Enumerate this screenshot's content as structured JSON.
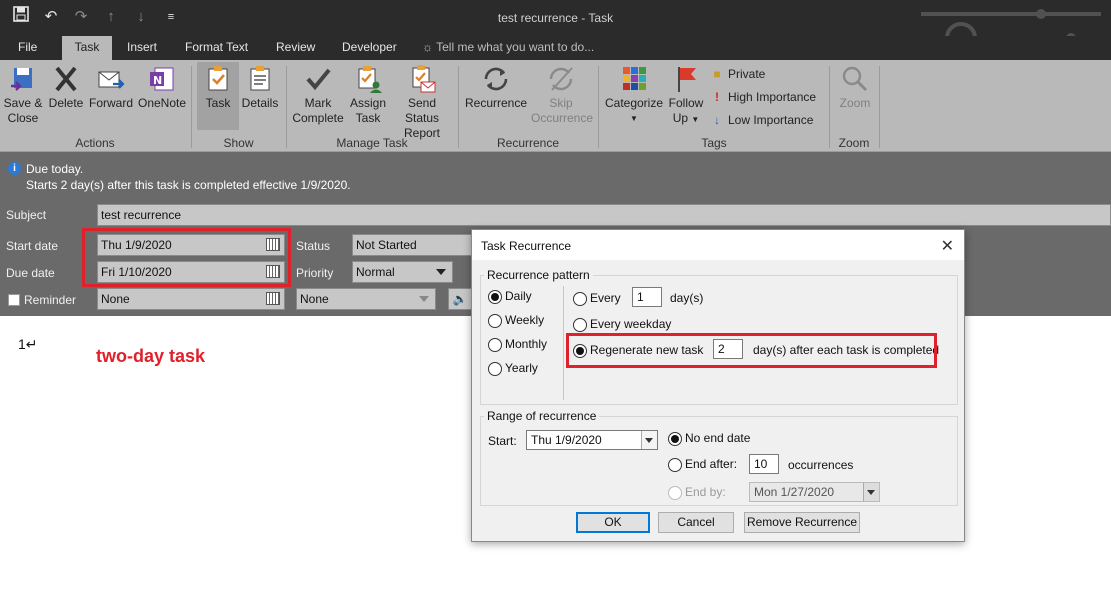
{
  "window": {
    "title": "test recurrence - Task"
  },
  "qat": {
    "save_icon": "save-icon",
    "undo_icon": "undo-icon",
    "redo_icon": "redo-icon",
    "up_icon": "up-icon",
    "down_icon": "down-icon",
    "more_icon": "customize-icon"
  },
  "menu_tabs": [
    "File",
    "Task",
    "Insert",
    "Format Text",
    "Review",
    "Developer"
  ],
  "tell_me": "Tell me what you want to do...",
  "ribbon": {
    "save_close_line1": "Save &",
    "save_close_line2": "Close",
    "delete": "Delete",
    "forward": "Forward",
    "onenote": "OneNote",
    "actions_group": "Actions",
    "task": "Task",
    "details": "Details",
    "show_group": "Show",
    "mark_line1": "Mark",
    "mark_line2": "Complete",
    "assign_line1": "Assign",
    "assign_line2": "Task",
    "send_line1": "Send Status",
    "send_line2": "Report",
    "manage_group": "Manage Task",
    "recurrence": "Recurrence",
    "skip_line1": "Skip",
    "skip_line2": "Occurrence",
    "recurrence_group": "Recurrence",
    "categorize": "Categorize",
    "follow_line1": "Follow",
    "follow_line2": "Up",
    "private": "Private",
    "high_importance": "High Importance",
    "low_importance": "Low Importance",
    "tags_group": "Tags",
    "zoom": "Zoom",
    "zoom_group": "Zoom"
  },
  "info": {
    "line1": "Due today.",
    "line2": "Starts 2 day(s) after this task is completed effective 1/9/2020."
  },
  "form": {
    "subject_label": "Subject",
    "subject_value": "test recurrence",
    "start_label": "Start date",
    "start_value": "Thu 1/9/2020",
    "due_label": "Due date",
    "due_value": "Fri 1/10/2020",
    "reminder_label": "Reminder",
    "reminder_date": "None",
    "reminder_time": "None",
    "status_label": "Status",
    "status_value": "Not Started",
    "priority_label": "Priority",
    "priority_value": "Normal"
  },
  "body": {
    "line_number": "1↵",
    "note": "two-day task"
  },
  "dialog": {
    "title": "Task Recurrence",
    "pattern_legend": "Recurrence pattern",
    "daily": "Daily",
    "weekly": "Weekly",
    "monthly": "Monthly",
    "yearly": "Yearly",
    "every": "Every",
    "every_value": "1",
    "every_unit": "day(s)",
    "every_weekday": "Every weekday",
    "regenerate": "Regenerate new task",
    "regenerate_value": "2",
    "regenerate_suffix": "day(s) after each task is completed",
    "range_legend": "Range of recurrence",
    "start_label": "Start:",
    "start_value": "Thu 1/9/2020",
    "no_end": "No end date",
    "end_after": "End after:",
    "end_after_value": "10",
    "occurrences": "occurrences",
    "end_by": "End by:",
    "end_by_value": "Mon 1/27/2020",
    "ok": "OK",
    "cancel": "Cancel",
    "remove": "Remove Recurrence"
  },
  "colors": {
    "highlight_red": "#e0202a",
    "ribbon_bg": "#b9b9b9",
    "titlebar_bg": "#2b2b2b",
    "form_bg": "#6a6a6a"
  }
}
